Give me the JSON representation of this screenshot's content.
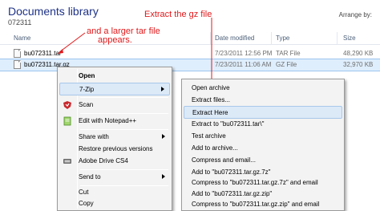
{
  "header": {
    "title": "Documents library",
    "subtitle": "072311",
    "arrange_label": "Arrange by:"
  },
  "columns": {
    "name": "Name",
    "date": "Date modified",
    "type": "Type",
    "size": "Size"
  },
  "files": [
    {
      "name": "bu072311.tar",
      "date": "7/23/2011 12:56 PM",
      "type": "TAR File",
      "size": "48,290 KB"
    },
    {
      "name": "bu072311.tar.gz",
      "date": "7/23/2011 11:06 AM",
      "type": "GZ File",
      "size": "32,970 KB"
    }
  ],
  "annotations": {
    "extract": "Extract the gz file",
    "tar_line1": "and a larger tar file",
    "tar_line2": "appears."
  },
  "context_menu": {
    "items": [
      {
        "label": "Open"
      },
      {
        "label": "7-Zip"
      },
      {
        "label": "Scan"
      },
      {
        "label": "Edit with Notepad++"
      },
      {
        "label": "Share with"
      },
      {
        "label": "Restore previous versions"
      },
      {
        "label": "Adobe Drive CS4"
      },
      {
        "label": "Send to"
      },
      {
        "label": "Cut"
      },
      {
        "label": "Copy"
      }
    ]
  },
  "submenu": {
    "items": [
      {
        "label": "Open archive"
      },
      {
        "label": "Extract files..."
      },
      {
        "label": "Extract Here"
      },
      {
        "label": "Extract to \"bu072311.tar\\\""
      },
      {
        "label": "Test archive"
      },
      {
        "label": "Add to archive..."
      },
      {
        "label": "Compress and email..."
      },
      {
        "label": "Add to \"bu072311.tar.gz.7z\""
      },
      {
        "label": "Compress to \"bu072311.tar.gz.7z\" and email"
      },
      {
        "label": "Add to \"bu072311.tar.gz.zip\""
      },
      {
        "label": "Compress to \"bu072311.tar.gz.zip\" and email"
      }
    ]
  },
  "colors": {
    "annotation_red": "#e1191b",
    "selection_blue": "#dfeefc",
    "title_blue": "#1e3287"
  }
}
